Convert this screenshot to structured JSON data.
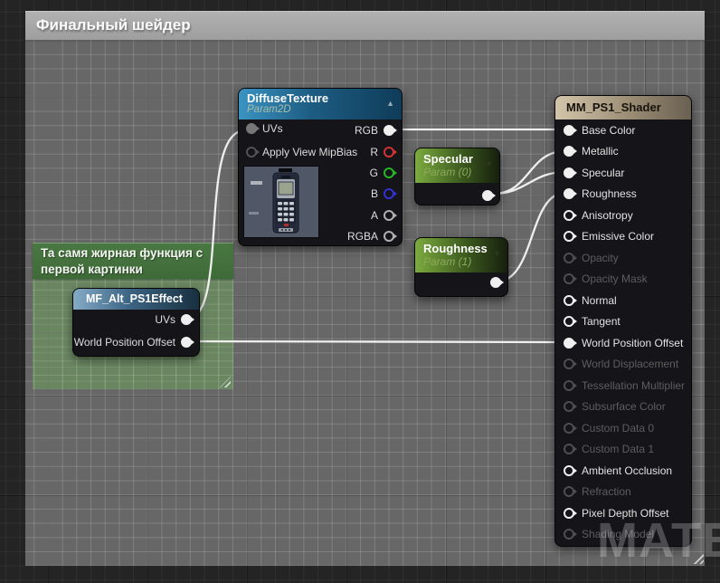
{
  "watermark": "MATERIAL",
  "comments": {
    "final_shader": {
      "title": "Финальный шейдер"
    },
    "function_box": {
      "title": "Та самя жирная функция с первой картинки"
    }
  },
  "nodes": {
    "diffuse_texture": {
      "title": "DiffuseTexture",
      "subtitle": "Param2D",
      "collapse_icon": "▲",
      "inputs": [
        {
          "label": "UVs",
          "connected": true
        },
        {
          "label": "Apply View MipBias",
          "connected": false
        }
      ],
      "outputs": [
        {
          "label": "RGB",
          "color": "#efefef",
          "connected": true
        },
        {
          "label": "R",
          "color": "#d23434",
          "connected": false
        },
        {
          "label": "G",
          "color": "#27b427",
          "connected": false
        },
        {
          "label": "B",
          "color": "#3232d2",
          "connected": false
        },
        {
          "label": "A",
          "color": "#b0b0b0",
          "connected": false
        },
        {
          "label": "RGBA",
          "color": "#b0b0b0",
          "connected": false
        }
      ],
      "preview": "old-mobile-phone-texture"
    },
    "specular_param": {
      "title": "Specular",
      "subtitle": "Param (0)",
      "dropdown_icon": "▼"
    },
    "roughness_param": {
      "title": "Roughness",
      "subtitle": "Param (1)",
      "dropdown_icon": "▼"
    },
    "material_function": {
      "title": "MF_Alt_PS1Effect",
      "outputs": [
        {
          "label": "UVs",
          "connected": true
        },
        {
          "label": "World Position Offset",
          "connected": true
        }
      ]
    },
    "result_node": {
      "title": "MM_PS1_Shader",
      "pins": [
        {
          "label": "Base Color",
          "state": "connected"
        },
        {
          "label": "Metallic",
          "state": "connected"
        },
        {
          "label": "Specular",
          "state": "connected"
        },
        {
          "label": "Roughness",
          "state": "connected"
        },
        {
          "label": "Anisotropy",
          "state": "open"
        },
        {
          "label": "Emissive Color",
          "state": "open"
        },
        {
          "label": "Opacity",
          "state": "disabled"
        },
        {
          "label": "Opacity Mask",
          "state": "disabled"
        },
        {
          "label": "Normal",
          "state": "open"
        },
        {
          "label": "Tangent",
          "state": "open"
        },
        {
          "label": "World Position Offset",
          "state": "connected"
        },
        {
          "label": "World Displacement",
          "state": "disabled"
        },
        {
          "label": "Tessellation Multiplier",
          "state": "disabled"
        },
        {
          "label": "Subsurface Color",
          "state": "disabled"
        },
        {
          "label": "Custom Data 0",
          "state": "disabled"
        },
        {
          "label": "Custom Data 1",
          "state": "disabled"
        },
        {
          "label": "Ambient Occlusion",
          "state": "open"
        },
        {
          "label": "Refraction",
          "state": "disabled"
        },
        {
          "label": "Pixel Depth Offset",
          "state": "open"
        },
        {
          "label": "Shading Model",
          "state": "disabled"
        }
      ]
    }
  },
  "connections": [
    {
      "from": "DiffuseTexture.RGB",
      "to": "MM_PS1_Shader.Base Color"
    },
    {
      "from": "Specular.output",
      "to": "MM_PS1_Shader.Metallic"
    },
    {
      "from": "Specular.output",
      "to": "MM_PS1_Shader.Specular"
    },
    {
      "from": "Roughness.output",
      "to": "MM_PS1_Shader.Roughness"
    },
    {
      "from": "MF_Alt_PS1Effect.UVs",
      "to": "DiffuseTexture.UVs"
    },
    {
      "from": "MF_Alt_PS1Effect.World Position Offset",
      "to": "MM_PS1_Shader.World Position Offset"
    }
  ],
  "colors": {
    "canvas_bg": "#242424",
    "comment_gray": "#989898",
    "comment_green": "#4a7842",
    "texture_header": "#2d85b4",
    "param_header": "#7cab3e",
    "result_header": "#d3c5aa",
    "function_header": "#84abc6",
    "wire": "#efefef"
  }
}
